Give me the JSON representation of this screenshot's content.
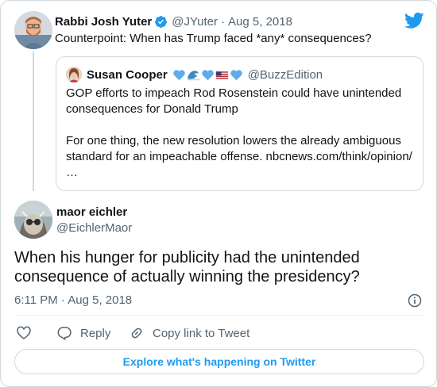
{
  "colors": {
    "accent": "#1d9bf0",
    "text_primary": "#0f1419",
    "text_secondary": "#536471",
    "border": "#cfd9de"
  },
  "parent_tweet": {
    "display_name": "Rabbi Josh Yuter",
    "verified_icon": "verified-badge-icon",
    "handle": "@JYuter",
    "separator": "·",
    "date": "Aug 5, 2018",
    "text": "Counterpoint: When has Trump faced *any* consequences?"
  },
  "quoted_tweet": {
    "display_name": "Susan Cooper",
    "name_emojis": [
      "blue-heart-emoji",
      "wave-emoji",
      "blue-heart-emoji",
      "us-flag-emoji",
      "blue-heart-emoji"
    ],
    "handle": "@BuzzEdition",
    "paragraph_1": "GOP efforts to impeach Rod Rosenstein could have unintended consequences for Donald Trump",
    "paragraph_2": "For one thing, the new resolution lowers the already ambiguous standard for an impeachable offense. nbcnews.com/think/opinion/",
    "ellipsis": "…"
  },
  "main_tweet": {
    "display_name": "maor eichler",
    "handle": "@EichlerMaor",
    "text": "When his hunger for publicity had the unintended consequence of actually winning the presidency?",
    "timestamp": "6:11 PM · Aug 5, 2018"
  },
  "actions": {
    "like_icon": "heart-icon",
    "reply_label": "Reply",
    "copy_link_label": "Copy link to Tweet"
  },
  "explore_button_label": "Explore what's happening on Twitter"
}
